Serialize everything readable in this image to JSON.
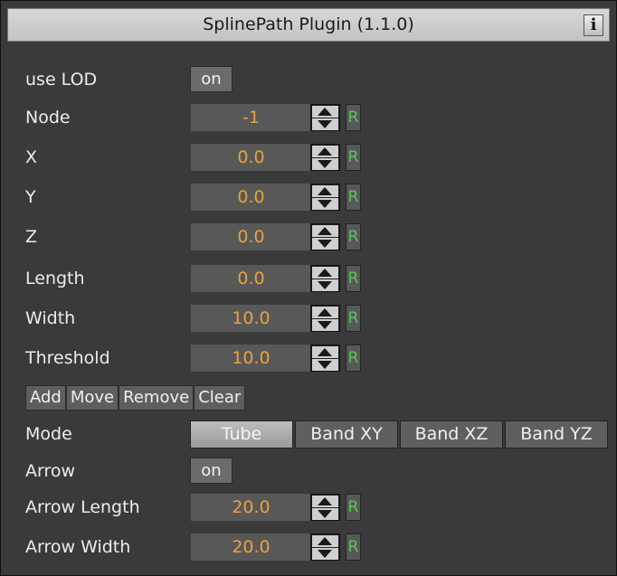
{
  "plugin": {
    "title": "SplinePath Plugin (1.1.0)",
    "info_label": "i"
  },
  "use_lod": {
    "label": "use LOD",
    "value": "on"
  },
  "params": [
    {
      "label": "Node",
      "value": "-1",
      "reset": "R"
    },
    {
      "label": "X",
      "value": "0.0",
      "reset": "R"
    },
    {
      "label": "Y",
      "value": "0.0",
      "reset": "R"
    },
    {
      "label": "Z",
      "value": "0.0",
      "reset": "R"
    },
    {
      "label": "Length",
      "value": "0.0",
      "reset": "R"
    },
    {
      "label": "Width",
      "value": "10.0",
      "reset": "R"
    },
    {
      "label": "Threshold",
      "value": "10.0",
      "reset": "R"
    }
  ],
  "actions": {
    "add": "Add",
    "move": "Move",
    "remove": "Remove",
    "clear": "Clear"
  },
  "mode": {
    "label": "Mode",
    "options": [
      "Tube",
      "Band XY",
      "Band XZ",
      "Band YZ"
    ],
    "selected": "Tube"
  },
  "arrow": {
    "label": "Arrow",
    "value": "on"
  },
  "arrow_params": [
    {
      "label": "Arrow Length",
      "value": "20.0",
      "reset": "R"
    },
    {
      "label": "Arrow Width",
      "value": "20.0",
      "reset": "R"
    }
  ],
  "colors": {
    "value_text": "#e8a33c",
    "reset_text": "#58c858",
    "panel_bg": "#3a3a3a"
  }
}
